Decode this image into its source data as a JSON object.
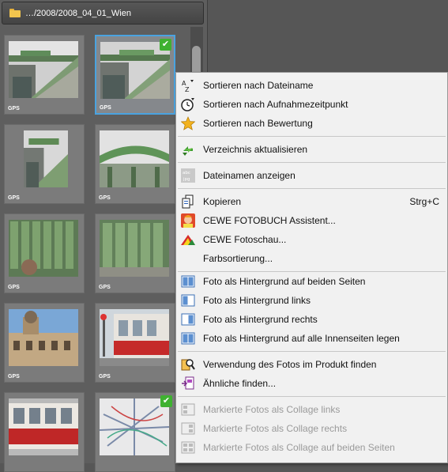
{
  "folder": {
    "path": "…/2008/2008_04_01_Wien"
  },
  "thumbnails": [
    {
      "gps": "GPS",
      "checked": false,
      "selected": false
    },
    {
      "gps": "GPS",
      "checked": true,
      "selected": true
    },
    {
      "gps": "GPS",
      "checked": false,
      "selected": false
    },
    {
      "gps": "GPS",
      "checked": false,
      "selected": false
    },
    {
      "gps": "GPS",
      "checked": false,
      "selected": false
    },
    {
      "gps": "GPS",
      "checked": false,
      "selected": false
    },
    {
      "gps": "GPS",
      "checked": false,
      "selected": false
    },
    {
      "gps": "GPS",
      "checked": false,
      "selected": false
    },
    {
      "gps": "",
      "checked": false,
      "selected": false
    },
    {
      "gps": "",
      "checked": true,
      "selected": false
    }
  ],
  "menu": {
    "sort_filename": "Sortieren nach Dateiname",
    "sort_time": "Sortieren nach Aufnahmezeitpunkt",
    "sort_rating": "Sortieren nach Bewertung",
    "refresh": "Verzeichnis aktualisieren",
    "show_filenames": "Dateinamen anzeigen",
    "copy": "Kopieren",
    "copy_shortcut": "Strg+C",
    "fotobuch": "CEWE FOTOBUCH Assistent...",
    "fotoschau": "CEWE Fotoschau...",
    "colorsort": "Farbsortierung...",
    "bg_both": "Foto als Hintergrund auf beiden Seiten",
    "bg_left": "Foto als Hintergrund links",
    "bg_right": "Foto als Hintergrund rechts",
    "bg_all": "Foto als Hintergrund auf alle Innenseiten legen",
    "find_usage": "Verwendung des Fotos im Produkt finden",
    "find_similar": "Ähnliche finden...",
    "collage_left": "Markierte Fotos als Collage links",
    "collage_right": "Markierte Fotos als Collage rechts",
    "collage_both": "Markierte Fotos als Collage auf beiden Seiten"
  },
  "colors": {
    "selection": "#4aa3e0",
    "check": "#3fb131",
    "menu_bg": "#f1f1f1",
    "disabled": "#9a9a9a"
  },
  "icons": [
    "sort-az-icon",
    "clock-icon",
    "star-icon",
    "refresh-icon",
    "filename-icon",
    "copy-icon",
    "fotobuch-icon",
    "fotoschau-icon",
    "page-both-icon",
    "page-left-icon",
    "page-right-icon",
    "page-all-icon",
    "find-usage-icon",
    "similar-icon",
    "collage-left-icon",
    "collage-right-icon",
    "collage-both-icon"
  ]
}
